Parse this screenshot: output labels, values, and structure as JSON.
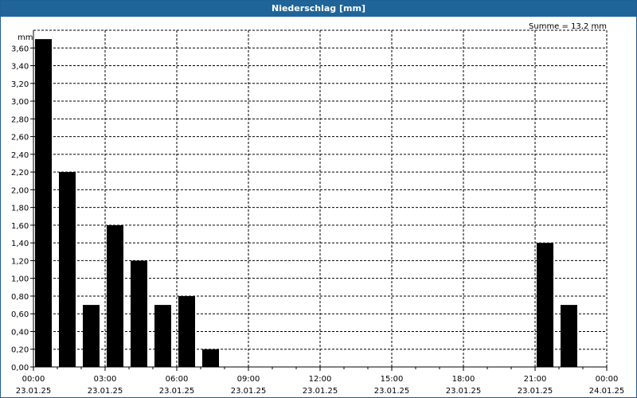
{
  "window": {
    "title": "Niederschlag [mm]"
  },
  "chart_data": {
    "type": "bar",
    "unit_label": "mm",
    "summary": "Summe = 13,2 mm",
    "ylim": [
      0,
      3.8
    ],
    "y_ticks": [
      "0,00",
      "0,20",
      "0,40",
      "0,60",
      "0,80",
      "1,00",
      "1,20",
      "1,40",
      "1,60",
      "1,80",
      "2,00",
      "2,20",
      "2,40",
      "2,60",
      "2,80",
      "3,00",
      "3,20",
      "3,40",
      "3,60"
    ],
    "x_ticks": [
      {
        "time": "00:00",
        "date": "23.01.25"
      },
      {
        "time": "03:00",
        "date": "23.01.25"
      },
      {
        "time": "06:00",
        "date": "23.01.25"
      },
      {
        "time": "09:00",
        "date": "23.01.25"
      },
      {
        "time": "12:00",
        "date": "23.01.25"
      },
      {
        "time": "15:00",
        "date": "23.01.25"
      },
      {
        "time": "18:00",
        "date": "23.01.25"
      },
      {
        "time": "21:00",
        "date": "23.01.25"
      },
      {
        "time": "00:00",
        "date": "24.01.25"
      }
    ],
    "bars": [
      {
        "hour": 0,
        "value": 3.7
      },
      {
        "hour": 1,
        "value": 2.2
      },
      {
        "hour": 2,
        "value": 0.7
      },
      {
        "hour": 3,
        "value": 1.6
      },
      {
        "hour": 4,
        "value": 1.2
      },
      {
        "hour": 5,
        "value": 0.7
      },
      {
        "hour": 6,
        "value": 0.8
      },
      {
        "hour": 7,
        "value": 0.2
      },
      {
        "hour": 21,
        "value": 1.4
      },
      {
        "hour": 22,
        "value": 0.7
      }
    ],
    "grid": true,
    "colors": {
      "bar": "#000000",
      "frame": "#1f6599",
      "grid": "#000000"
    }
  }
}
